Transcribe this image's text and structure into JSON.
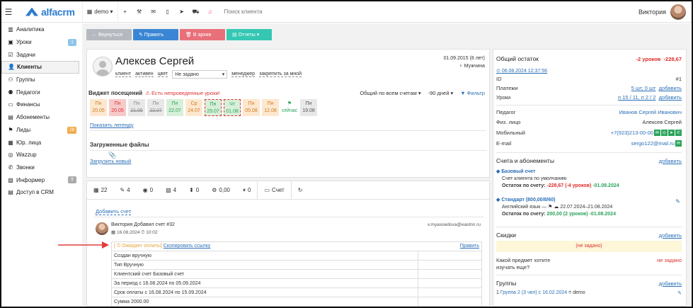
{
  "topbar": {
    "menu_icon": "hamburger-icon",
    "logo": "alfacrm",
    "branch": "demo",
    "search_placeholder": "Поиск клиента",
    "user": "Виктория"
  },
  "sidebar": {
    "items": [
      {
        "label": "Аналитика",
        "icon": "chart-icon"
      },
      {
        "label": "Уроки",
        "icon": "calendar-icon",
        "badge": "1",
        "badge_color": "#8ec6e8"
      },
      {
        "label": "Задачи",
        "icon": "tasks-icon"
      },
      {
        "label": "Клиенты",
        "icon": "user-icon"
      },
      {
        "label": "Группы",
        "icon": "users-icon"
      },
      {
        "label": "Педагоги",
        "icon": "teacher-icon"
      },
      {
        "label": "Финансы",
        "icon": "money-icon"
      },
      {
        "label": "Абонементы",
        "icon": "card-icon"
      },
      {
        "label": "Лиды",
        "icon": "lead-icon",
        "badge": "28",
        "badge_color": "#f0ad4e"
      },
      {
        "label": "Юр. лица",
        "icon": "building-icon"
      },
      {
        "label": "Wazzup",
        "icon": "whatsapp-icon"
      },
      {
        "label": "Звонки",
        "icon": "phone-icon"
      },
      {
        "label": "Информер",
        "icon": "info-icon",
        "badge": "9",
        "badge_color": "#aaaaaa"
      },
      {
        "label": "Доступ в CRM",
        "icon": "lock-icon"
      }
    ],
    "active": 3
  },
  "buttons": {
    "back": "← Вернуться",
    "edit": "✎ Править",
    "archive": "🗑 В архив",
    "reports": "▤ Отчеты ▾"
  },
  "client": {
    "name": "Алексев Сергей",
    "birth": "01.09.2015 (8 лет)",
    "gender": "♀ Мужчина",
    "tags": [
      "клиент",
      "активен",
      "цвет"
    ],
    "status_select": "Не задано",
    "manager": "менеджер",
    "lock": "закрепить за мной"
  },
  "widget": {
    "title": "Виджет посещений",
    "warning": "⚠ Есть непроведенные уроки!",
    "scope": "Общий по всем счетам",
    "range": "-90 дней",
    "filter": "Фильтр",
    "legend": "Показать легенду",
    "days": [
      {
        "day": "Пн",
        "date": "20.05",
        "bg": "#fde7cf",
        "color": "#d07a1b"
      },
      {
        "day": "Пн",
        "date": "20.05",
        "bg": "#f8c9c9",
        "color": "#d33"
      },
      {
        "day": "Пн",
        "date": "21.05",
        "bg": "#e8e8e8",
        "color": "#888"
      },
      {
        "day": "Пн",
        "date": "22.07",
        "bg": "#e8e8e8",
        "color": "#888"
      },
      {
        "day": "Пн",
        "date": "22.07",
        "bg": "#d7efd9",
        "color": "#2aa35a"
      },
      {
        "day": "Ср",
        "date": "24.07",
        "bg": "#fde7cf",
        "color": "#d07a1b"
      },
      {
        "day": "Пн",
        "date": "29.07",
        "bg": "#d7efd9",
        "color": "#2aa35a"
      },
      {
        "day": "Чт",
        "date": "01.08",
        "bg": "#d7efd9",
        "color": "#2aa35a"
      },
      {
        "day": "Пн",
        "date": "05.08",
        "bg": "#fde7cf",
        "color": "#d07a1b"
      },
      {
        "day": "Пн",
        "date": "12.08",
        "bg": "#fde7cf",
        "color": "#d07a1b"
      },
      {
        "day": "",
        "date": "сейчас",
        "bg": "#fff",
        "color": "#2aa35a"
      },
      {
        "day": "Пн",
        "date": "19.08",
        "bg": "#e8e8e8",
        "color": "#555"
      }
    ]
  },
  "files": {
    "title": "Загруженные файлы",
    "upload": "Загрузить новый"
  },
  "tabs": [
    {
      "icon": "▦",
      "label": "22"
    },
    {
      "icon": "✎",
      "label": "4"
    },
    {
      "icon": "◉",
      "label": "0"
    },
    {
      "icon": "▧",
      "label": "4"
    },
    {
      "icon": "⬍",
      "label": "0"
    },
    {
      "icon": "⚙",
      "label": "0,00"
    },
    {
      "icon": "⏸",
      "label": "0"
    },
    {
      "icon": "▭",
      "label": "Счет"
    },
    {
      "icon": "↻",
      "label": ""
    }
  ],
  "invoice": {
    "add": "Добавить счет",
    "author": "Виктория Добавил счет #32",
    "date": "16.08.2024",
    "time": "10:02",
    "email": "v.myasoedova@eastnn.ru",
    "status": "[ ⏱ Ожидает оплаты]",
    "copy": "Скопировать ссылку",
    "edit": "Править",
    "rows": [
      "Создан вручную",
      "Тип Вручную",
      "Клиентский счет Базовый счет",
      "За период с 16.08.2024 по 05.09.2024",
      "Срок оплаты с 16.08.2024 по 15.09.2024",
      "Сумма 2000.00"
    ]
  },
  "right": {
    "balance_title": "Общий остаток",
    "balance_lessons": "-2 уроков",
    "balance_sum": "-228,67",
    "balance_date": "06.08.2024 12:37:56",
    "id_label": "ID",
    "id_val": "#1",
    "payments_label": "Платежи",
    "payments_val": "5 шт, 0 шт",
    "lessons_label": "Уроки",
    "lessons_val": "п 15 / 11, п 2 / 2",
    "add": "добавить",
    "teacher_label": "Педагог",
    "teacher_val": "Иванов Сергей Иванович",
    "person_label": "Физ. лицо",
    "person_val": "Алексев Сергей",
    "mobile_label": "Мобильный",
    "mobile_val": "+7(923)213-00-00",
    "email_label": "E-mail",
    "email_val": "sergo122@mail.ru",
    "accounts_title": "Счета и абонементы",
    "base_acc": "Базовый счет",
    "base_default": "Счет клиента по умолчанию",
    "base_balance": "Остаток по счету:",
    "base_sum": "-228,67 (-4 уроков)",
    "base_date": "-01.08.2024",
    "std_acc": "Стандарт (800,00/8/60)",
    "std_lang": "Английский язык — ⚑ ☁ 22.07.2024–21.08.2024",
    "std_balance": "Остаток по счету:",
    "std_sum": "200,00 (2 уроков)",
    "std_date": "-01.08.2024",
    "discounts": "Скидки",
    "not_set": "(не задано)",
    "subject_q": "Какой предмет хотите изучать еще?",
    "subject_val": "не задано",
    "groups": "Группы",
    "group_val": "Группа 2 (3 чел) с 16.02.2024",
    "group_branch": "demo"
  }
}
